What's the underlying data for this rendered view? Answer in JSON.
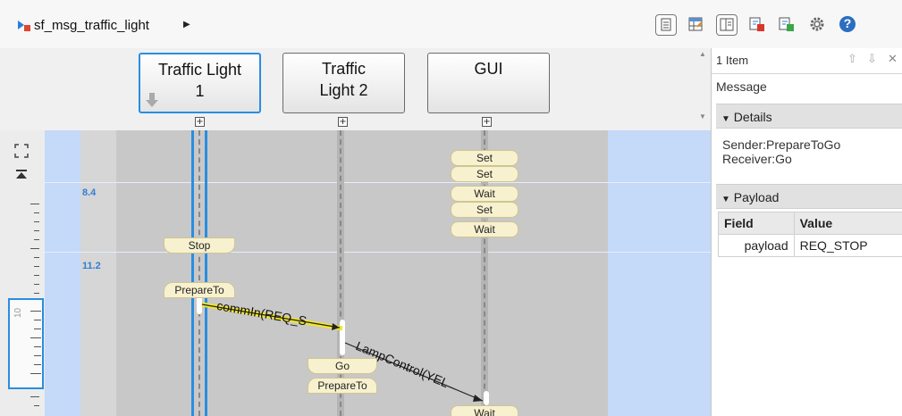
{
  "breadcrumb": {
    "model_name": "sf_msg_traffic_light"
  },
  "toolbar": {
    "buttons": [
      "properties-icon",
      "table-icon",
      "panel-icon",
      "export-icon",
      "import-icon",
      "gear-icon",
      "help-icon"
    ],
    "help_label": "?"
  },
  "lanes": [
    {
      "title": "Traffic Light 1",
      "line1": "Traffic Light",
      "line2": "1",
      "selected": true
    },
    {
      "title": "Traffic Light 2",
      "line1": "Traffic",
      "line2": "Light 2",
      "selected": false
    },
    {
      "title": "GUI",
      "line1": "GUI",
      "line2": "",
      "selected": false
    }
  ],
  "expander_label": "+",
  "timeline": {
    "time_labels": [
      "8.4",
      "11.2"
    ],
    "ruler_label": "10",
    "messages": {
      "tl1": [
        "Stop",
        "PrepareTo"
      ],
      "tl2": [
        "Go",
        "PrepareTo"
      ],
      "gui": [
        "Set",
        "Set",
        "Wait",
        "Set",
        "Wait",
        "Wait"
      ]
    },
    "arrows": [
      "commIn(REQ_S",
      "LampControl(YEL"
    ]
  },
  "panel": {
    "item_count": "1 Item",
    "kind": "Message",
    "details_title": "Details",
    "sender": "Sender:PrepareToGo",
    "receiver": "Receiver:Go",
    "payload_title": "Payload",
    "payload_table": {
      "headers": [
        "Field",
        "Value"
      ],
      "rows": [
        [
          "payload",
          "REQ_STOP"
        ]
      ]
    }
  },
  "colors": {
    "selection": "#2a8de0",
    "highlight_arrow": "#f2e52a",
    "message_fill": "#f8f1cf",
    "time_label": "#2f7ed8"
  }
}
